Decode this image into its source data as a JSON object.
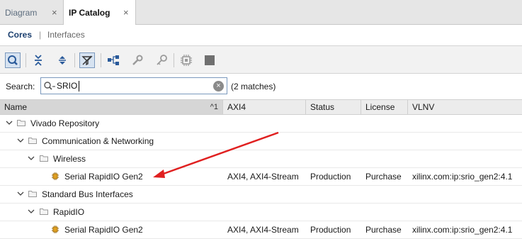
{
  "tabs": [
    {
      "label": "Diagram",
      "close": "×"
    },
    {
      "label": "IP Catalog",
      "close": "×"
    }
  ],
  "subtabs": {
    "cores": "Cores",
    "separator": "|",
    "interfaces": "Interfaces"
  },
  "toolbar": {
    "buttons": [
      "search-icon",
      "collapse-all-icon",
      "expand-all-icon",
      "filter-icon",
      "hierarchy-icon",
      "wrench-icon",
      "key-icon",
      "chip-icon",
      "stop-icon"
    ]
  },
  "search": {
    "label": "Search:",
    "value": "SRIO",
    "matches": "(2 matches)",
    "clear": "×"
  },
  "columns": {
    "name": "Name",
    "sort": "^1",
    "axi": "AXI4",
    "status": "Status",
    "license": "License",
    "vlnv": "VLNV"
  },
  "tree": [
    {
      "label": "Vivado Repository"
    },
    {
      "label": "Communication & Networking"
    },
    {
      "label": "Wireless"
    },
    {
      "label": "Serial RapidIO Gen2",
      "axi": "AXI4, AXI4-Stream",
      "status": "Production",
      "license": "Purchase",
      "vlnv": "xilinx.com:ip:srio_gen2:4.1"
    },
    {
      "label": "Standard Bus Interfaces"
    },
    {
      "label": "RapidIO"
    },
    {
      "label": "Serial RapidIO Gen2",
      "axi": "AXI4, AXI4-Stream",
      "status": "Production",
      "license": "Purchase",
      "vlnv": "xilinx.com:ip:srio_gen2:4.1"
    }
  ],
  "colors": {
    "annotation_arrow": "#e02020",
    "selected_tab_accent": "#ffffff"
  }
}
